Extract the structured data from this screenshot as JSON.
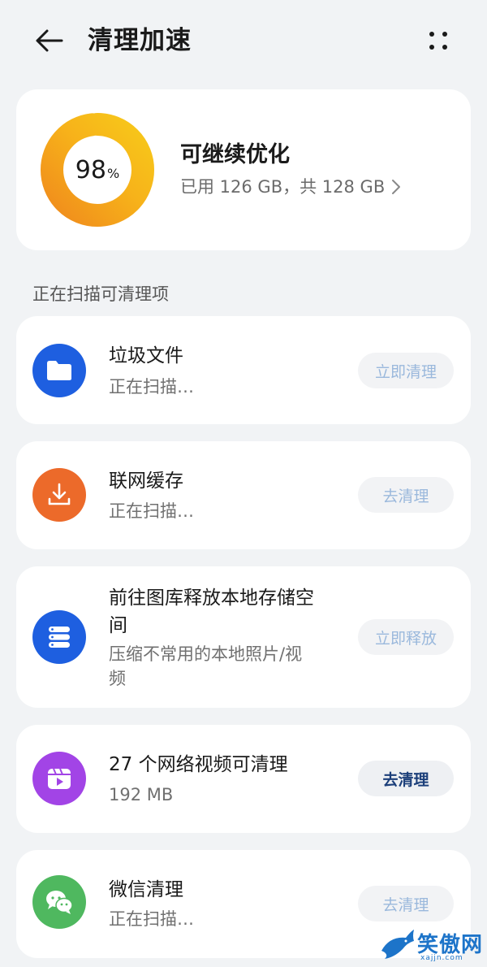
{
  "header": {
    "title": "清理加速",
    "back_icon": "arrow-left-icon",
    "more_icon": "more-dots-icon"
  },
  "storage": {
    "percent": "98",
    "percent_unit": "%",
    "percent_value": 98,
    "title": "可继续优化",
    "summary": "已用 126 GB，共 128 GB",
    "ring_colors": [
      "#f7c21a",
      "#f08c1c"
    ]
  },
  "section_label": "正在扫描可清理项",
  "items": [
    {
      "title": "垃圾文件",
      "subtitle": "正在扫描…",
      "action": "立即清理",
      "icon": "folder-icon",
      "icon_color": "#1e5fe0"
    },
    {
      "title": "联网缓存",
      "subtitle": "正在扫描…",
      "action": "去清理",
      "icon": "download-icon",
      "icon_color": "#ec6a2a"
    },
    {
      "title_line1": "前往图库释放本地存储空",
      "title_line2": "间",
      "subtitle_line1": "压缩不常用的本地照片/视",
      "subtitle_line2": "频",
      "action": "立即释放",
      "icon": "storage-stack-icon",
      "icon_color": "#1e5fe0"
    },
    {
      "title": "27 个网络视频可清理",
      "subtitle": "192 MB",
      "action": "去清理",
      "icon": "video-icon",
      "icon_color": "#a244e6"
    },
    {
      "title": "微信清理",
      "subtitle": "正在扫描…",
      "action": "去清理",
      "icon": "wechat-icon",
      "icon_color": "#4fb85f"
    }
  ],
  "watermark": {
    "text": "笑傲网",
    "url": "xajjn.com",
    "icon": "shark-logo-icon"
  }
}
